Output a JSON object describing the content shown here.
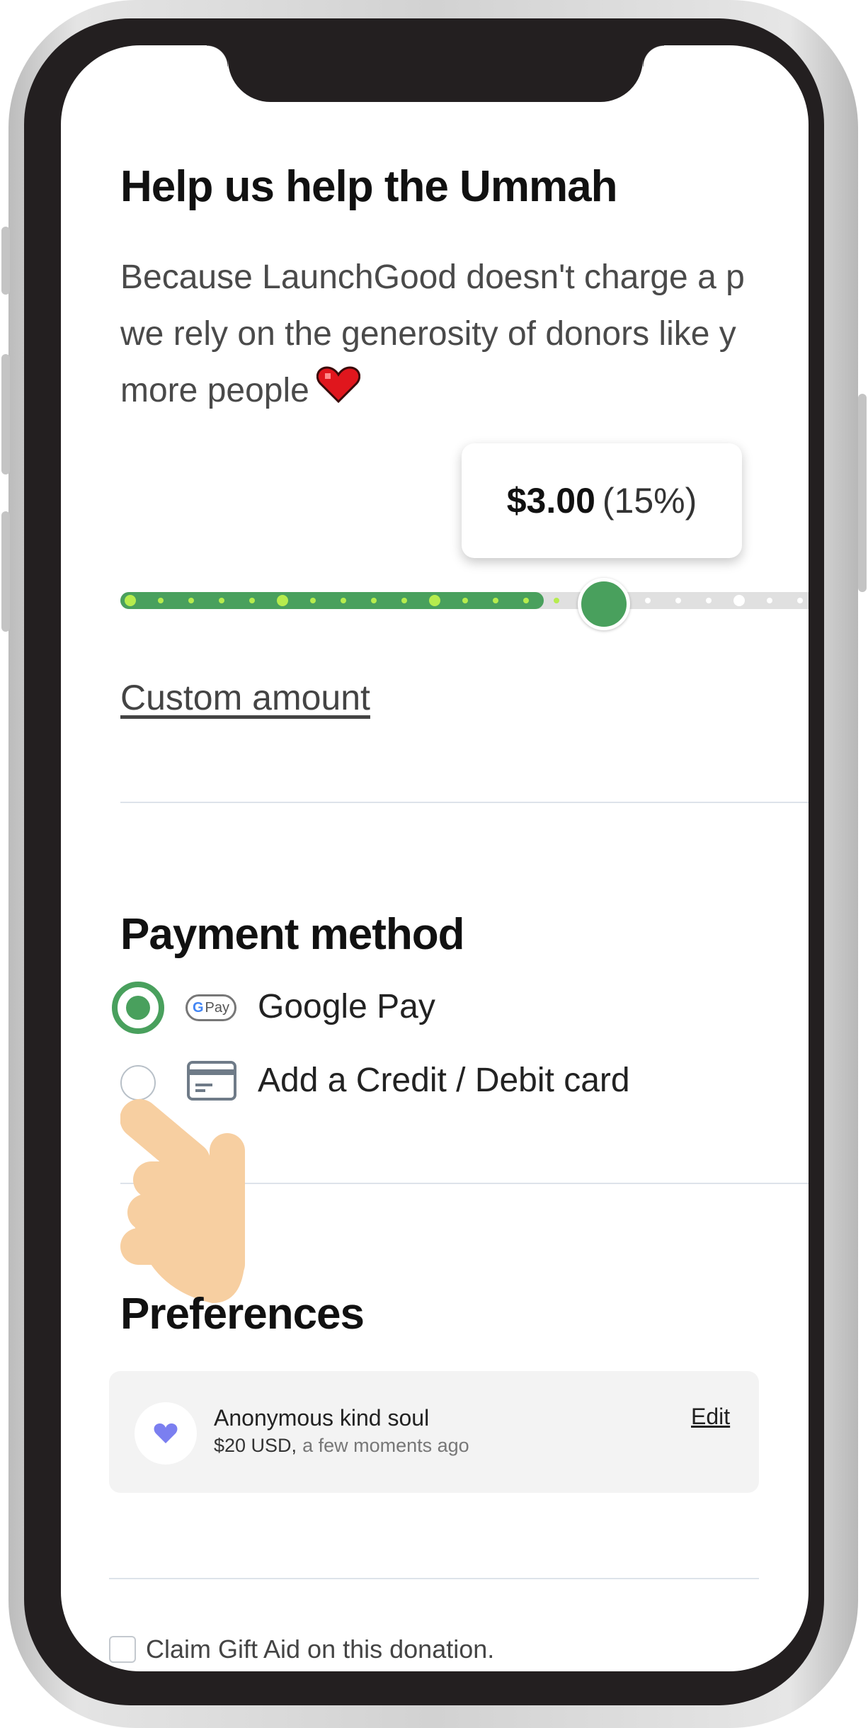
{
  "donation": {
    "title": "Help us help the Ummah",
    "description_lines": [
      "Because LaunchGood doesn't charge a p",
      "we rely on the generosity of donors like y",
      "more people"
    ],
    "heart_icon": "heart-icon",
    "tip_amount": "$3.00",
    "tip_percent": "(15%)",
    "tip_slider_level_percent": 15,
    "custom_amount_label": "Custom amount"
  },
  "payment": {
    "title": "Payment method",
    "options": [
      {
        "label": "Google Pay",
        "icon": "google-pay-icon",
        "selected": true
      },
      {
        "label": "Add a Credit / Debit card",
        "icon": "credit-card-icon",
        "selected": false
      }
    ]
  },
  "preferences": {
    "title": "Preferences",
    "donor_name": "Anonymous kind soul",
    "amount": "$20 USD,",
    "time": "a few moments ago",
    "edit_label": "Edit"
  },
  "gift_aid": {
    "label": "Claim Gift Aid on this donation.",
    "checked": false
  },
  "colors": {
    "accent_green": "#49a05d",
    "heart_red": "#e0161d",
    "avatar_heart": "#7b7ff0",
    "hand": "#f7cfa1"
  }
}
